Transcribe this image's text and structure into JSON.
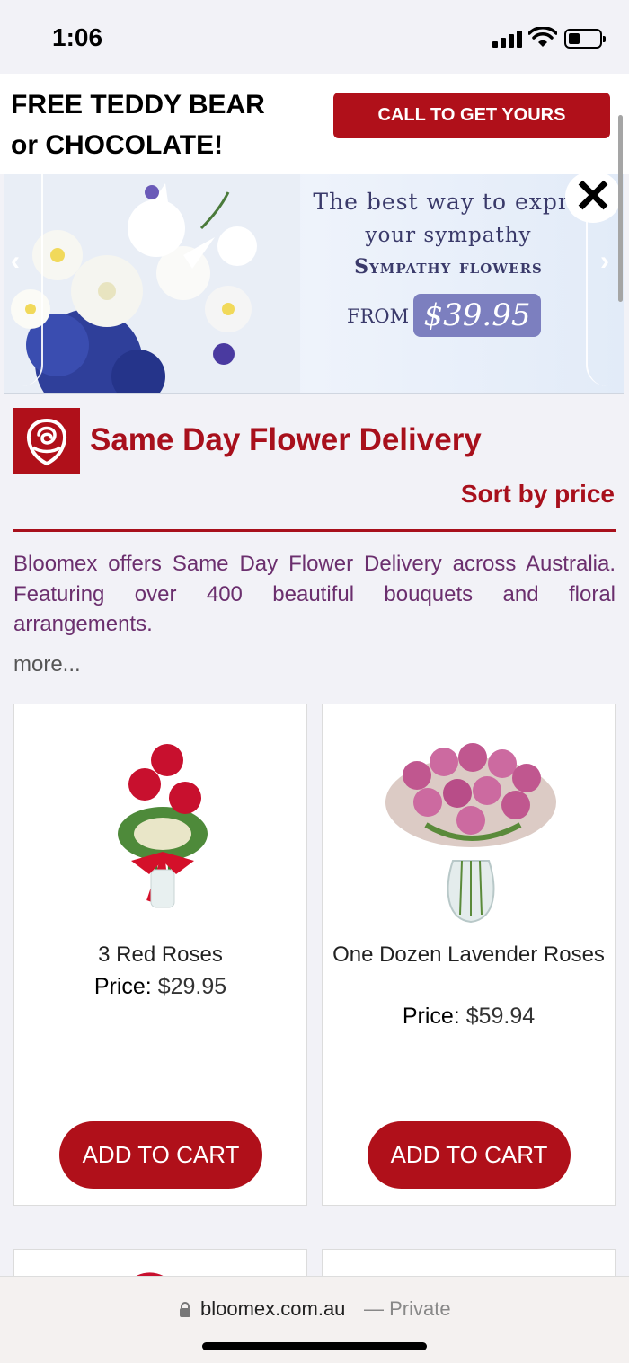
{
  "status_bar": {
    "time": "1:06"
  },
  "promo": {
    "text_line1": "FREE TEDDY BEAR",
    "text_line2": "or CHOCOLATE!",
    "button_label": "CALL TO GET YOURS"
  },
  "banner": {
    "line1": "The best way to expre",
    "line2": "your sympathy",
    "line3": "Sympathy flowers",
    "from_label": "FROM",
    "price": "$39.95",
    "prev_icon": "‹",
    "next_icon": "›",
    "close_icon": "✕"
  },
  "page": {
    "title": "Same Day Flower Delivery",
    "sort_label": "Sort by price",
    "intro": "Bloomex offers Same Day Flower Delivery across Australia. Featuring over 400 beautiful bouquets and floral arrangements.",
    "more_label": "more..."
  },
  "products": [
    {
      "name": "3 Red Roses",
      "price_label": "Price:",
      "price": "$29.95",
      "cart_label": "ADD TO CART"
    },
    {
      "name": "One Dozen Lavender Roses",
      "price_label": "Price:",
      "price": "$59.94",
      "cart_label": "ADD TO CART"
    }
  ],
  "browser": {
    "host": "bloomex.com.au",
    "private_label": "— Private"
  },
  "colors": {
    "brand_red": "#b0101a",
    "intro_purple": "#6b2f6e",
    "banner_price_bg": "#7c7fbf"
  }
}
